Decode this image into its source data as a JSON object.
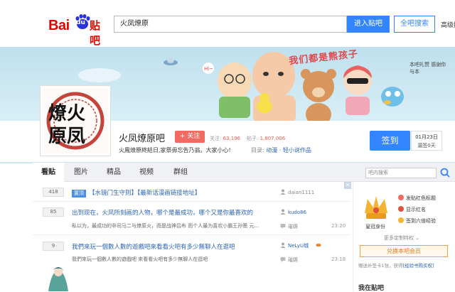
{
  "header": {
    "logo_bai": "Bai",
    "logo_du": "du",
    "logo_tieba": "贴吧",
    "search_value": "火凤燎原",
    "enter_button": "进入贴吧",
    "all_search_button": "全吧搜索",
    "advanced_search": "高级搜索"
  },
  "banner": {
    "title": "我们都是熊孩子",
    "gift_text": "本吧礼赞 感谢你与本"
  },
  "forum": {
    "logo_text": "燎原火凤",
    "name": "火凤燎原吧",
    "follow_button": "+ 关注",
    "members_label": "关注:",
    "members_count": "63,196",
    "posts_label": "帖子:",
    "posts_count": "1,807,006",
    "slogan": "火鳳燎原終結日,家祭毋忘告乃翁。大家小心!",
    "directory_label": "目录:",
    "directory_value": "动漫 · 轻小说作品",
    "signin_button": "签到",
    "signin_date": "01月23日",
    "signin_streak": "漏签0天"
  },
  "tabs": [
    {
      "label": "看贴",
      "active": true
    },
    {
      "label": "图片",
      "active": false
    },
    {
      "label": "精品",
      "active": false
    },
    {
      "label": "视频",
      "active": false
    },
    {
      "label": "群组",
      "active": false
    }
  ],
  "forum_search_placeholder": "吧内搜索",
  "threads": [
    {
      "replies": "418",
      "tag": "置顶",
      "title": "【水镜门生守则】【最新话漫画链接地址】",
      "author": "daian1111",
      "abstract": "",
      "last_user": "",
      "time": ""
    },
    {
      "replies": "85",
      "tag": "",
      "title": "出到现在，火凤所刻画的人物，哪个是最成功，哪个又是你最喜欢的",
      "author": "kudo86",
      "abstract": "私以为，最成功的非司马二与燎原火，而是战神吕布 而个人最为喜欢小霸王孙策 元...",
      "last_user": "璀嬿",
      "time": "23:20"
    },
    {
      "replies": "9",
      "tag": "",
      "title": "我們來玩一個數人數的遊戲吧來看看火吧有多少無聊人在逛吧",
      "author": "NeLyU城",
      "abstract": "我們來玩一個數人數的遊戲吧 來看看火吧有多少無聊人在逛吧",
      "last_user": "璀嬿",
      "time": "23:18"
    }
  ],
  "sidebar": {
    "crown_label": "皇冠身份",
    "perks": [
      "发贴红色标题",
      "显示红名",
      "签到六倍经验"
    ],
    "more_perks": "更多定制特权 ⌄",
    "member_button": "兑换本吧会员",
    "supplement_text": "赠送补签卡1张，获得",
    "supplement_link": "[经验书购买权]",
    "in_forum_title": "我在贴吧"
  },
  "colors": {
    "accent_blue": "#3385ff",
    "brand_red": "#e10601",
    "follow_red": "#f26b62",
    "link_blue": "#2d64b3"
  }
}
